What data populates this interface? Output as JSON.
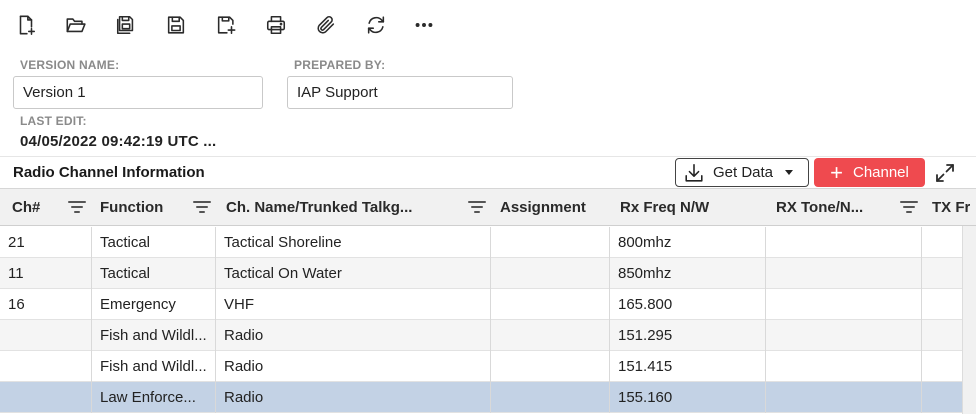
{
  "toolbar": {
    "icons": [
      "new-document-icon",
      "open-folder-icon",
      "save-copies-icon",
      "save-icon",
      "save-as-icon",
      "print-icon",
      "attach-icon",
      "refresh-icon",
      "more-icon"
    ]
  },
  "form": {
    "version_name_label": "VERSION NAME:",
    "version_name_value": "Version 1",
    "prepared_by_label": "PREPARED BY:",
    "prepared_by_value": "IAP Support",
    "last_edit_label": "LAST EDIT:",
    "last_edit_value": "04/05/2022 09:42:19 UTC ..."
  },
  "section": {
    "title": "Radio Channel Information",
    "get_data_label": "Get Data",
    "add_channel_label": "Channel"
  },
  "table": {
    "columns": [
      "Ch#",
      "Function",
      "Ch. Name/Trunked Talkg...",
      "Assignment",
      "Rx Freq N/W",
      "RX Tone/N...",
      "TX Fr"
    ],
    "rows": [
      {
        "ch": "21",
        "function": "Tactical",
        "name": "Tactical Shoreline",
        "assignment": "",
        "rx_freq": "800mhz",
        "rx_tone": "",
        "tx": ""
      },
      {
        "ch": "11",
        "function": "Tactical",
        "name": "Tactical On Water",
        "assignment": "",
        "rx_freq": "850mhz",
        "rx_tone": "",
        "tx": ""
      },
      {
        "ch": "16",
        "function": "Emergency",
        "name": "VHF",
        "assignment": "",
        "rx_freq": "165.800",
        "rx_tone": "",
        "tx": ""
      },
      {
        "ch": "",
        "function": "Fish and Wildl...",
        "name": "Radio",
        "assignment": "",
        "rx_freq": "151.295",
        "rx_tone": "",
        "tx": ""
      },
      {
        "ch": "",
        "function": "Fish and Wildl...",
        "name": "Radio",
        "assignment": "",
        "rx_freq": "151.415",
        "rx_tone": "",
        "tx": ""
      },
      {
        "ch": "",
        "function": "Law Enforce...",
        "name": "Radio",
        "assignment": "",
        "rx_freq": "155.160",
        "rx_tone": "",
        "tx": ""
      }
    ]
  },
  "colors": {
    "accent_red": "#ef4a4f",
    "selected_row": "#c3d2e5",
    "header_bg": "#f1f1f1"
  }
}
